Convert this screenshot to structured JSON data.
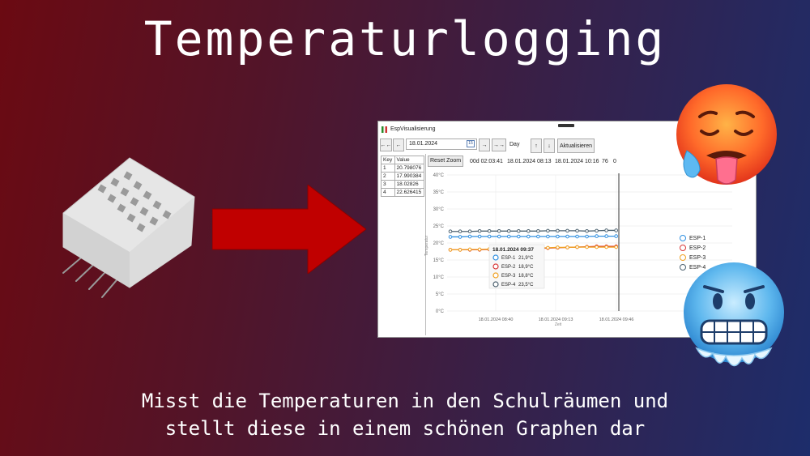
{
  "title": "Temperaturlogging",
  "subtitle_line1": "Misst die Temperaturen in den Schulräumen und",
  "subtitle_line2": "stellt diese in einem schönen Graphen dar",
  "window": {
    "title": "EspVisualisierung",
    "toolbar": {
      "back_fast": "←←",
      "back": "←",
      "date": "18.01.2024",
      "calendar_day": "15",
      "forward": "→",
      "forward_fast": "→→",
      "range": "Day",
      "up": "↑",
      "down": "↓",
      "refresh": "Aktualisieren"
    },
    "table": {
      "headers": [
        "Key",
        "Value"
      ],
      "rows": [
        [
          "1",
          "20.798076"
        ],
        [
          "2",
          "17.990384"
        ],
        [
          "3",
          "18.02826"
        ],
        [
          "4",
          "22.626415"
        ]
      ]
    },
    "reset_zoom": "Reset Zoom",
    "info_duration": "00d 02:03:41",
    "info_start": "18.01.2024 08:13",
    "info_end": "18.01.2024 10:16",
    "info_count": "76",
    "info_zero": "0"
  },
  "chart_data": {
    "type": "line",
    "y_ticks": [
      "0°C",
      "5°C",
      "10°C",
      "15°C",
      "20°C",
      "25°C",
      "30°C",
      "35°C",
      "40°C"
    ],
    "ylim": [
      0,
      40
    ],
    "ylabel": "Temperatur",
    "xlabel": "Zeit",
    "x_ticks": [
      "18.01.2024 08:40",
      "18.01.2024 09:13",
      "18.01.2024 09:46"
    ],
    "x_points": [
      "08:13",
      "08:19",
      "08:25",
      "08:31",
      "08:37",
      "08:43",
      "08:49",
      "08:55",
      "09:01",
      "09:07",
      "09:13",
      "09:19",
      "09:25",
      "09:31",
      "09:37",
      "09:43",
      "09:49",
      "09:55"
    ],
    "series": [
      {
        "name": "ESP-1",
        "color": "#2f8fe0",
        "values": [
          21.8,
          21.8,
          21.9,
          21.9,
          21.9,
          21.9,
          21.9,
          21.9,
          21.9,
          21.9,
          21.9,
          21.9,
          21.9,
          21.9,
          21.9,
          22.0,
          22.0,
          22.0
        ]
      },
      {
        "name": "ESP-2",
        "color": "#d93838",
        "values": [
          18.0,
          18.0,
          18.0,
          18.0,
          18.1,
          18.1,
          18.2,
          18.2,
          18.3,
          18.4,
          18.5,
          18.6,
          18.7,
          18.8,
          18.9,
          19.0,
          19.0,
          19.0
        ]
      },
      {
        "name": "ESP-3",
        "color": "#f0a020",
        "values": [
          18.0,
          18.0,
          18.1,
          18.1,
          18.2,
          18.3,
          18.4,
          18.5,
          18.5,
          18.6,
          18.6,
          18.7,
          18.7,
          18.8,
          18.8,
          18.8,
          18.8,
          18.8
        ]
      },
      {
        "name": "ESP-4",
        "color": "#4d6270",
        "values": [
          23.4,
          23.4,
          23.4,
          23.5,
          23.5,
          23.5,
          23.5,
          23.5,
          23.5,
          23.5,
          23.6,
          23.6,
          23.6,
          23.6,
          23.5,
          23.6,
          23.7,
          23.7
        ]
      }
    ],
    "tooltip": {
      "title": "18.01.2024 09:37",
      "rows": [
        {
          "name": "ESP-1",
          "value": "21,9°C"
        },
        {
          "name": "ESP-2",
          "value": "18,9°C"
        },
        {
          "name": "ESP-3",
          "value": "18,8°C"
        },
        {
          "name": "ESP-4",
          "value": "23,5°C"
        }
      ]
    },
    "legend_position": "right",
    "grid": true
  }
}
